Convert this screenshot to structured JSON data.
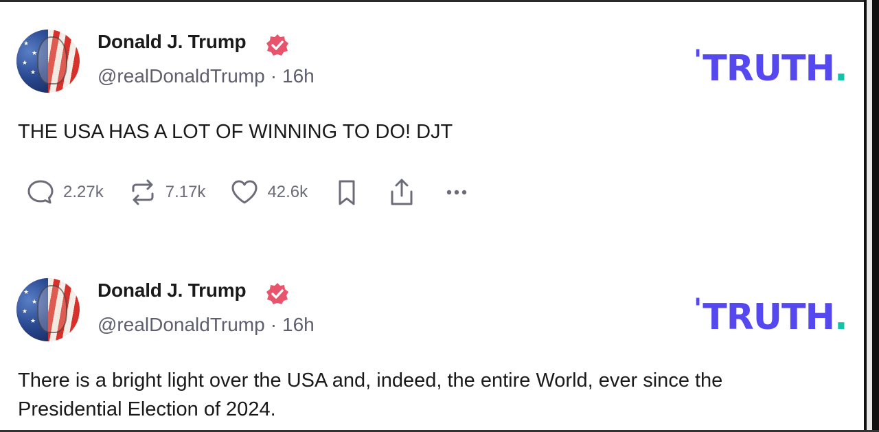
{
  "posts": [
    {
      "author": {
        "name": "Donald J. Trump",
        "handle": "@realDonaldTrump",
        "separator": "·",
        "time": "16h"
      },
      "logo": {
        "text": "TRUTH",
        "dot": "."
      },
      "text": "THE USA HAS A LOT OF WINNING TO DO! DJT",
      "actions": {
        "reply_count": "2.27k",
        "retruth_count": "7.17k",
        "like_count": "42.6k"
      }
    },
    {
      "author": {
        "name": "Donald J. Trump",
        "handle": "@realDonaldTrump",
        "separator": "·",
        "time": "16h"
      },
      "logo": {
        "text": "TRUTH",
        "dot": "."
      },
      "text_line1": "There is a bright light over the USA and, indeed, the entire World, ever since the",
      "text_line2": "Presidential Election of 2024."
    }
  ],
  "colors": {
    "brand": "#5448ee",
    "brand_dot": "#12c3a8",
    "verified": "#e8546c",
    "text": "#1a1a1a",
    "muted": "#5e5e6e"
  },
  "icons": [
    "reply-icon",
    "retruth-icon",
    "like-icon",
    "bookmark-icon",
    "share-icon",
    "more-icon",
    "verified-badge-icon"
  ]
}
